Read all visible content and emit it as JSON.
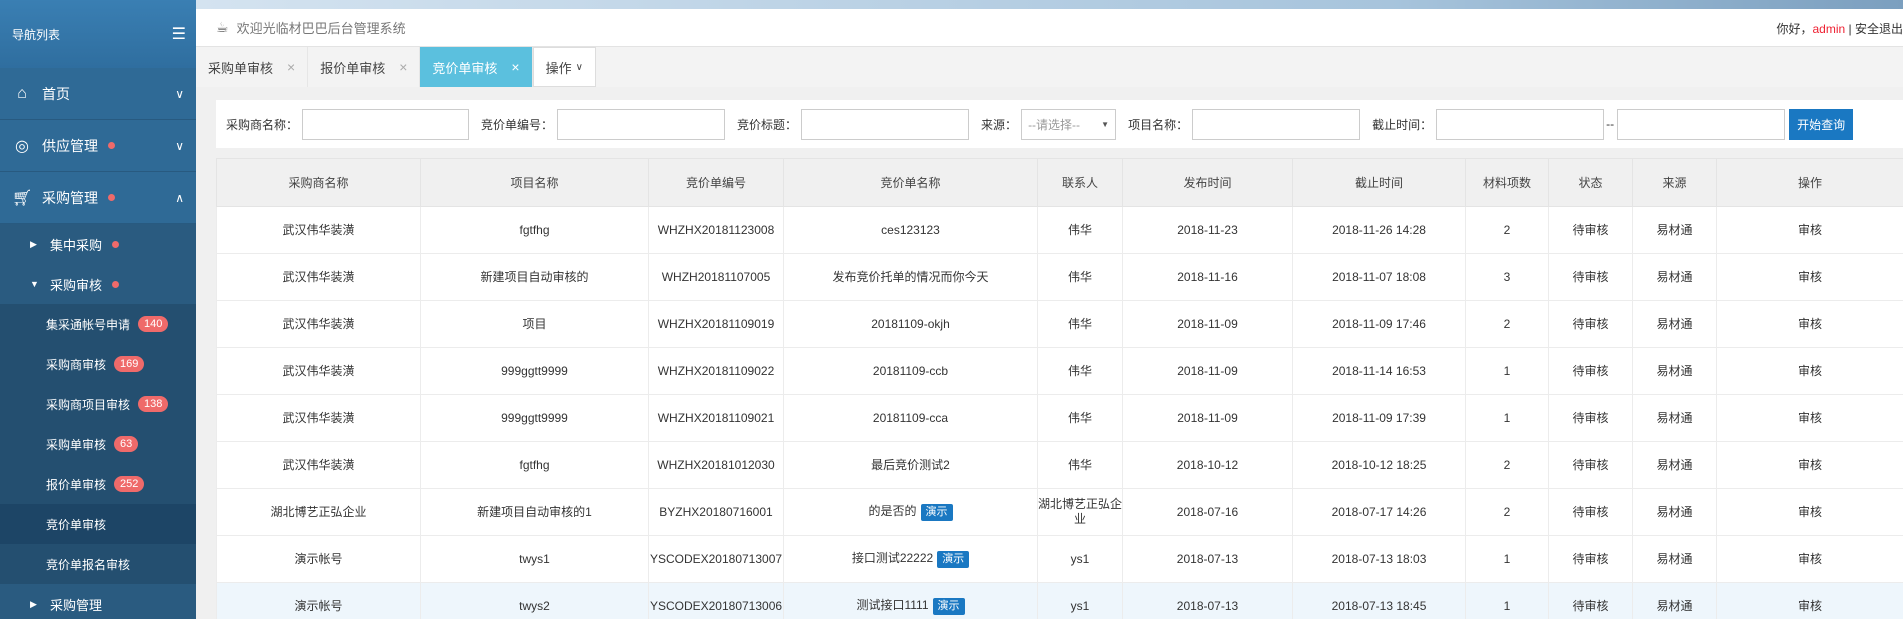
{
  "sidebar": {
    "title": "导航列表",
    "menus": [
      {
        "label": "首页",
        "icon": "home-icon",
        "chev": "∨",
        "dot": false
      },
      {
        "label": "供应管理",
        "icon": "supply-icon",
        "chev": "∨",
        "dot": true
      },
      {
        "label": "采购管理",
        "icon": "cart-icon",
        "chev": "∧",
        "dot": true
      }
    ],
    "group1": {
      "label": "集中采购"
    },
    "group2": {
      "label": "采购审核"
    },
    "items": [
      {
        "label": "集采通帐号申请",
        "badge": "140"
      },
      {
        "label": "采购商审核",
        "badge": "169"
      },
      {
        "label": "采购商项目审核",
        "badge": "138"
      },
      {
        "label": "采购单审核",
        "badge": "63"
      },
      {
        "label": "报价单审核",
        "badge": "252"
      },
      {
        "label": "竞价单审核"
      },
      {
        "label": "竞价单报名审核"
      }
    ],
    "group3": {
      "label": "采购管理"
    }
  },
  "header": {
    "welcome": "欢迎光临材巴巴后台管理系统",
    "greeting": "你好，",
    "user": "admin",
    "sep": " | ",
    "logout": "安全退出"
  },
  "tabs": [
    {
      "label": "采购单审核",
      "close": "×"
    },
    {
      "label": "报价单审核",
      "close": "×"
    },
    {
      "label": "竞价单审核",
      "close": "×"
    }
  ],
  "tab_op": "操作",
  "search": {
    "buyer_label": "采购商名称：",
    "code_label": "竞价单编号：",
    "title_label": "竞价标题：",
    "source_label": "来源：",
    "source_value": "--请选择--",
    "project_label": "项目名称：",
    "deadline_label": "截止时间：",
    "dash": "--",
    "button": "开始查询"
  },
  "table": {
    "headers": [
      "采购商名称",
      "项目名称",
      "竞价单编号",
      "竞价单名称",
      "联系人",
      "发布时间",
      "截止时间",
      "材料项数",
      "状态",
      "来源",
      "操作"
    ],
    "rows": [
      {
        "buyer": "武汉伟华装潢",
        "project": "fgtfhg",
        "code": "WHZHX20181123008",
        "name": "ces123123",
        "tag": "",
        "contact": "伟华",
        "pub": "2018-11-23",
        "deadline": "2018-11-26 14:28",
        "count": "2",
        "status": "待审核",
        "source": "易材通",
        "op": "审核"
      },
      {
        "buyer": "武汉伟华装潢",
        "project": "新建项目自动审核的",
        "code": "WHZH20181107005",
        "name": "发布竞价托单的情况而你今天",
        "tag": "",
        "contact": "伟华",
        "pub": "2018-11-16",
        "deadline": "2018-11-07 18:08",
        "count": "3",
        "status": "待审核",
        "source": "易材通",
        "op": "审核"
      },
      {
        "buyer": "武汉伟华装潢",
        "project": "项目",
        "code": "WHZHX20181109019",
        "name": "20181109-okjh",
        "tag": "",
        "contact": "伟华",
        "pub": "2018-11-09",
        "deadline": "2018-11-09 17:46",
        "count": "2",
        "status": "待审核",
        "source": "易材通",
        "op": "审核"
      },
      {
        "buyer": "武汉伟华装潢",
        "project": "999ggtt9999",
        "code": "WHZHX20181109022",
        "name": "20181109-ccb",
        "tag": "",
        "contact": "伟华",
        "pub": "2018-11-09",
        "deadline": "2018-11-14 16:53",
        "count": "1",
        "status": "待审核",
        "source": "易材通",
        "op": "审核"
      },
      {
        "buyer": "武汉伟华装潢",
        "project": "999ggtt9999",
        "code": "WHZHX20181109021",
        "name": "20181109-cca",
        "tag": "",
        "contact": "伟华",
        "pub": "2018-11-09",
        "deadline": "2018-11-09 17:39",
        "count": "1",
        "status": "待审核",
        "source": "易材通",
        "op": "审核"
      },
      {
        "buyer": "武汉伟华装潢",
        "project": "fgtfhg",
        "code": "WHZHX20181012030",
        "name": "最后竞价测试2",
        "tag": "",
        "contact": "伟华",
        "pub": "2018-10-12",
        "deadline": "2018-10-12 18:25",
        "count": "2",
        "status": "待审核",
        "source": "易材通",
        "op": "审核"
      },
      {
        "buyer": "湖北博艺正弘企业",
        "project": "新建项目自动审核的1",
        "code": "BYZHX20180716001",
        "name": "的是否的",
        "tag": "演示",
        "contact": "湖北博艺正弘企业",
        "pub": "2018-07-16",
        "deadline": "2018-07-17 14:26",
        "count": "2",
        "status": "待审核",
        "source": "易材通",
        "op": "审核"
      },
      {
        "buyer": "演示帐号",
        "project": "twys1",
        "code": "YSCODEX20180713007",
        "name": "接口测试22222",
        "tag": "演示",
        "contact": "ys1",
        "pub": "2018-07-13",
        "deadline": "2018-07-13 18:03",
        "count": "1",
        "status": "待审核",
        "source": "易材通",
        "op": "审核"
      },
      {
        "buyer": "演示帐号",
        "project": "twys2",
        "code": "YSCODEX20180713006",
        "name": "测试接口1111",
        "tag": "演示",
        "contact": "ys1",
        "pub": "2018-07-13",
        "deadline": "2018-07-13 18:45",
        "count": "1",
        "status": "待审核",
        "source": "易材通",
        "op": "审核"
      }
    ]
  }
}
